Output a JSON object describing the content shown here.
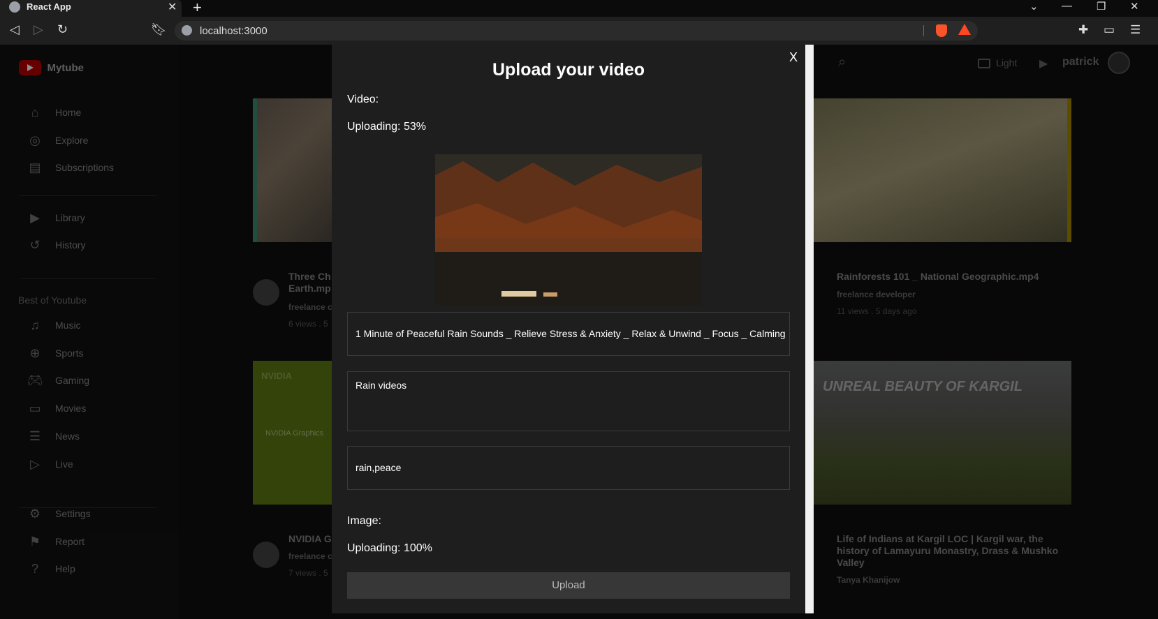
{
  "browser": {
    "tab_title": "React App",
    "tab_close": "✕",
    "new_tab": "+",
    "url": "localhost:3000"
  },
  "app": {
    "logo": "Mytube",
    "sidebar": {
      "items_top": [
        {
          "label": "Home",
          "icon": "home-icon"
        },
        {
          "label": "Explore",
          "icon": "explore-icon"
        },
        {
          "label": "Subscriptions",
          "icon": "subscriptions-icon"
        }
      ],
      "items_lib": [
        {
          "label": "Library",
          "icon": "library-icon"
        },
        {
          "label": "History",
          "icon": "history-icon"
        }
      ],
      "section_title": "Best of Youtube",
      "items_best": [
        {
          "label": "Music",
          "icon": "music-icon"
        },
        {
          "label": "Sports",
          "icon": "sports-icon"
        },
        {
          "label": "Gaming",
          "icon": "gaming-icon"
        },
        {
          "label": "Movies",
          "icon": "movies-icon"
        },
        {
          "label": "News",
          "icon": "news-icon"
        },
        {
          "label": "Live",
          "icon": "live-icon"
        }
      ],
      "items_bottom": [
        {
          "label": "Settings",
          "icon": "settings-icon"
        },
        {
          "label": "Report",
          "icon": "report-icon"
        },
        {
          "label": "Help",
          "icon": "help-icon"
        }
      ]
    },
    "header": {
      "theme_label": "Light",
      "username": "patrick"
    },
    "cards": [
      {
        "title": "Three Ch\nEarth.mp",
        "channel": "freelance c",
        "meta": "6 views . 5"
      },
      {
        "title": "Rainforests 101 _ National Geographic.mp4",
        "channel": "freelance developer",
        "meta": "11 views . 5 days ago"
      },
      {
        "title": "NVIDIA G",
        "channel": "freelance c",
        "meta": "7 views . 5",
        "thumb_text": "NVIDIA Graphics",
        "brand": "NVIDIA"
      },
      {
        "title": "Life of Indians at Kargil LOC | Kargil war, the history of Lamayuru Monastry, Drass & Mushko Valley",
        "channel": "Tanya Khanijow",
        "thumb_text": "UNREAL BEAUTY OF KARGIL"
      }
    ]
  },
  "modal": {
    "title": "Upload your video",
    "close": "X",
    "video_label": "Video:",
    "video_progress": "Uploading: 53%",
    "video_progress_value": 53,
    "title_value": "1 Minute of Peaceful Rain Sounds _ Relieve Stress & Anxiety _ Relax & Unwind _ Focus _ Calming",
    "description_value": "Rain videos",
    "tags_value": "rain,peace",
    "image_label": "Image:",
    "image_progress": "Uploading: 100%",
    "image_progress_value": 100,
    "upload_button": "Upload"
  }
}
